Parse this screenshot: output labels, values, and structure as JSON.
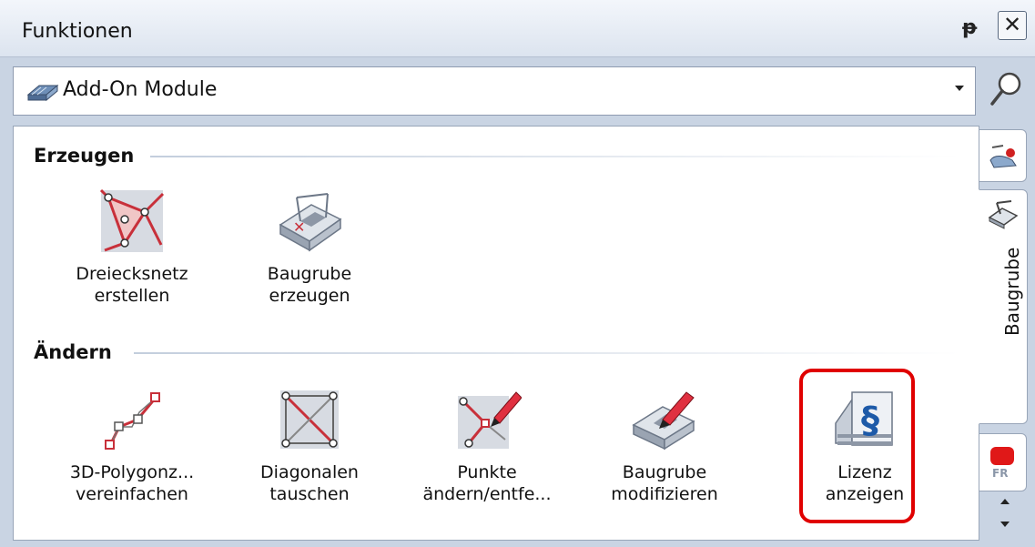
{
  "panel": {
    "title": "Funktionen",
    "pin_label": "ᵽ",
    "close_label": "✕"
  },
  "dropdown": {
    "selected": "Add-On Module",
    "icon": "add-on-module-icon"
  },
  "sections": [
    {
      "title": "Erzeugen",
      "tools": [
        {
          "line1": "Dreiecksnetz",
          "line2": "erstellen",
          "icon": "triangle-mesh-icon"
        },
        {
          "line1": "Baugrube",
          "line2": "erzeugen",
          "icon": "excavation-create-icon"
        }
      ]
    },
    {
      "title": "Ändern",
      "tools": [
        {
          "line1": "3D-Polygonz...",
          "line2": "vereinfachen",
          "icon": "polyline-simplify-icon"
        },
        {
          "line1": "Diagonalen",
          "line2": "tauschen",
          "icon": "swap-diagonals-icon"
        },
        {
          "line1": "Punkte",
          "line2": "ändern/entfe...",
          "icon": "edit-points-icon"
        },
        {
          "line1": "Baugrube",
          "line2": "modifizieren",
          "icon": "excavation-modify-icon"
        },
        {
          "line1": "Lizenz",
          "line2": "anzeigen",
          "icon": "license-paragraph-icon"
        }
      ]
    }
  ],
  "side_tabs": {
    "active_label": "Baugrube",
    "bottom_badge": "FR"
  },
  "colors": {
    "highlight": "#e00000",
    "accent_red": "#c8303a",
    "panel_bg": "#c9d4e3"
  }
}
